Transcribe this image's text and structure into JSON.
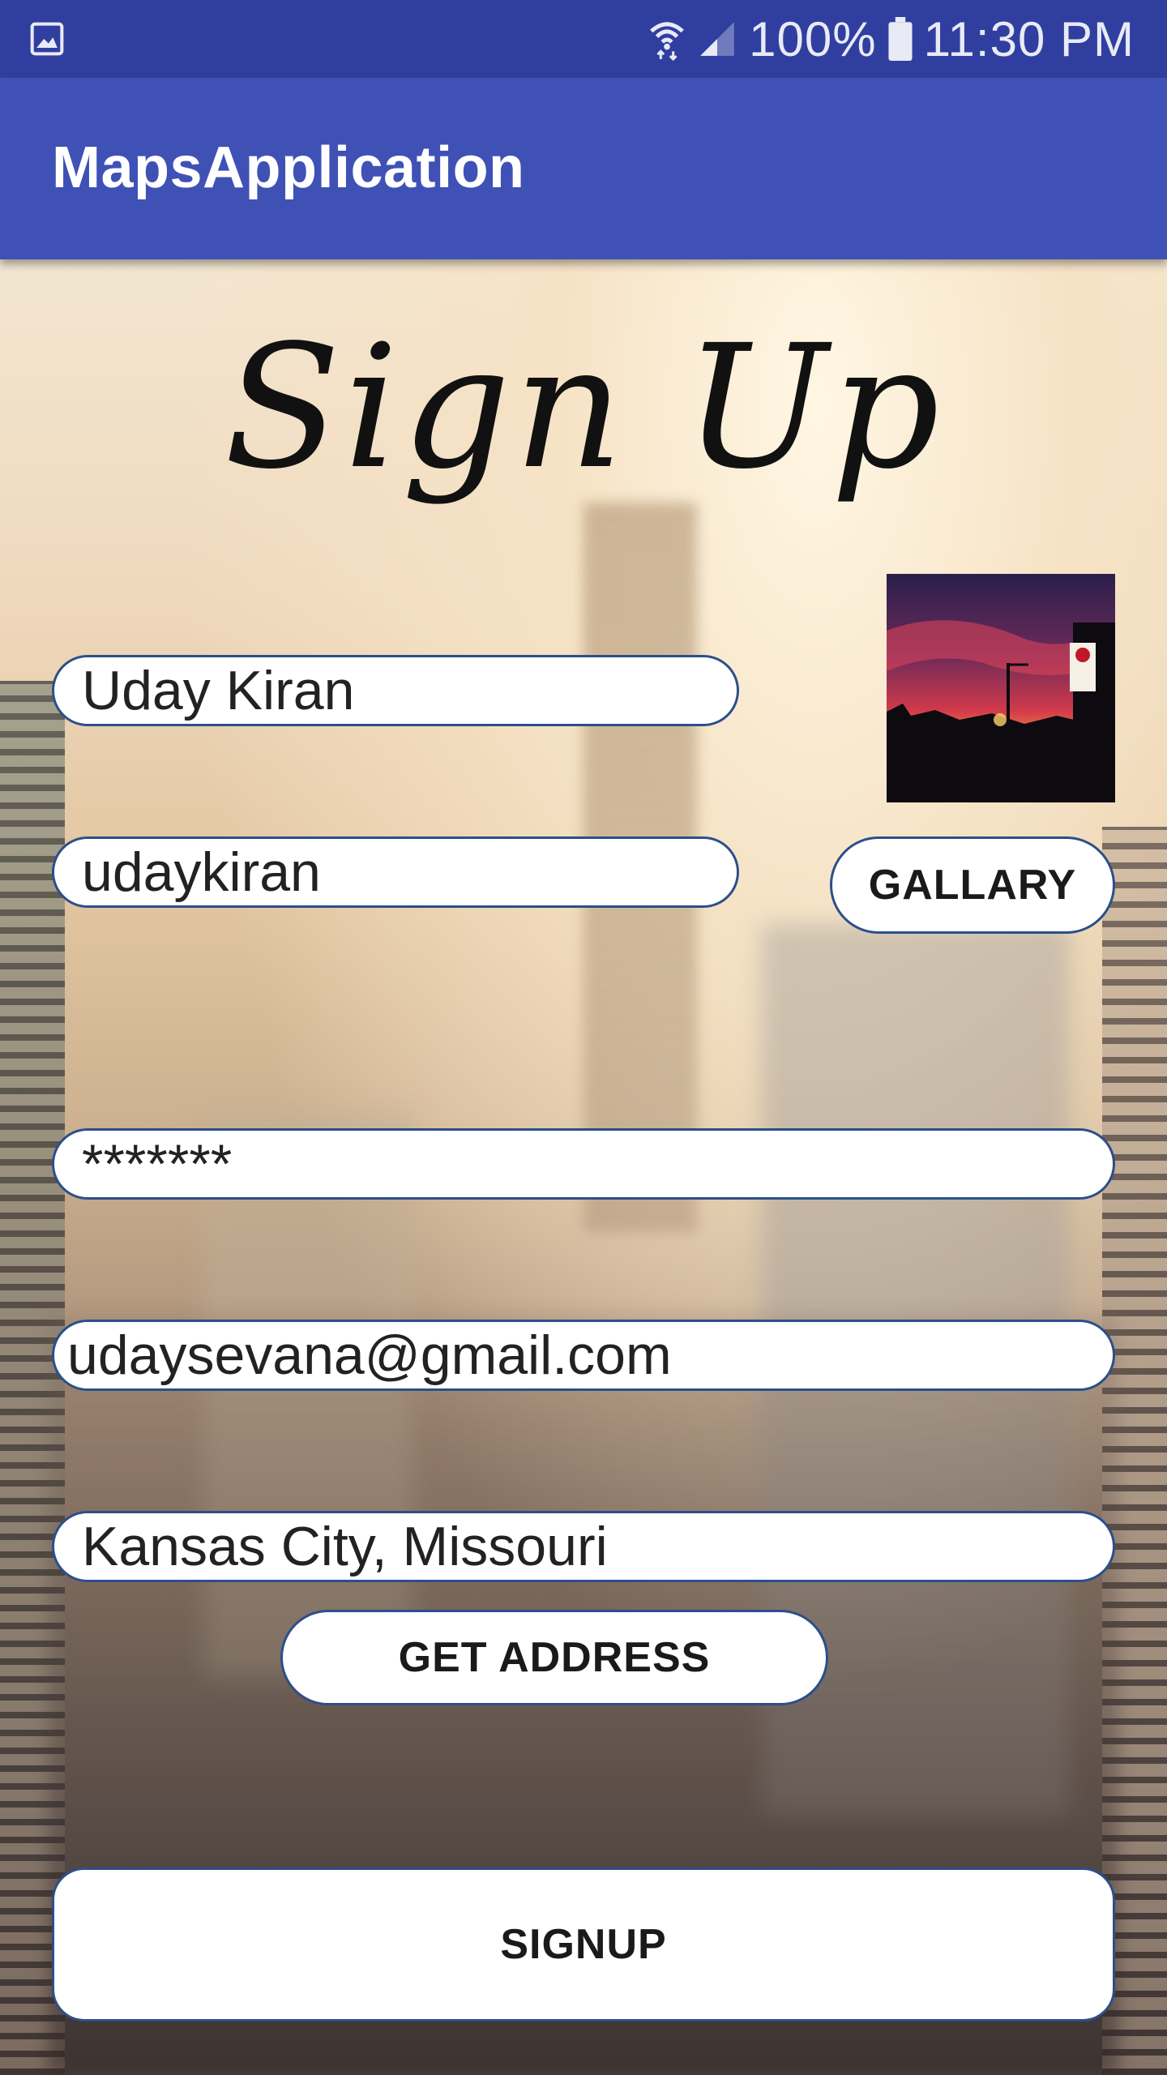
{
  "status_bar": {
    "battery": "100%",
    "time": "11:30 PM",
    "icons": [
      "gallery-icon",
      "wifi-icon",
      "signal-icon",
      "battery-icon"
    ]
  },
  "app_bar": {
    "title": "MapsApplication"
  },
  "form": {
    "heading": "Sign Up",
    "name_value": "Uday Kiran",
    "username_value": "udaykiran",
    "password_value": "*******",
    "email_value": "udaysevana@gmail.com",
    "address_value": "Kansas City, Missouri",
    "gallery_button": "GALLARY",
    "get_address_button": "GET ADDRESS",
    "signup_button": "SIGNUP"
  },
  "colors": {
    "status_bar": "#303f9f",
    "app_bar": "#3f51b5",
    "field_border": "#2b4f8a"
  }
}
